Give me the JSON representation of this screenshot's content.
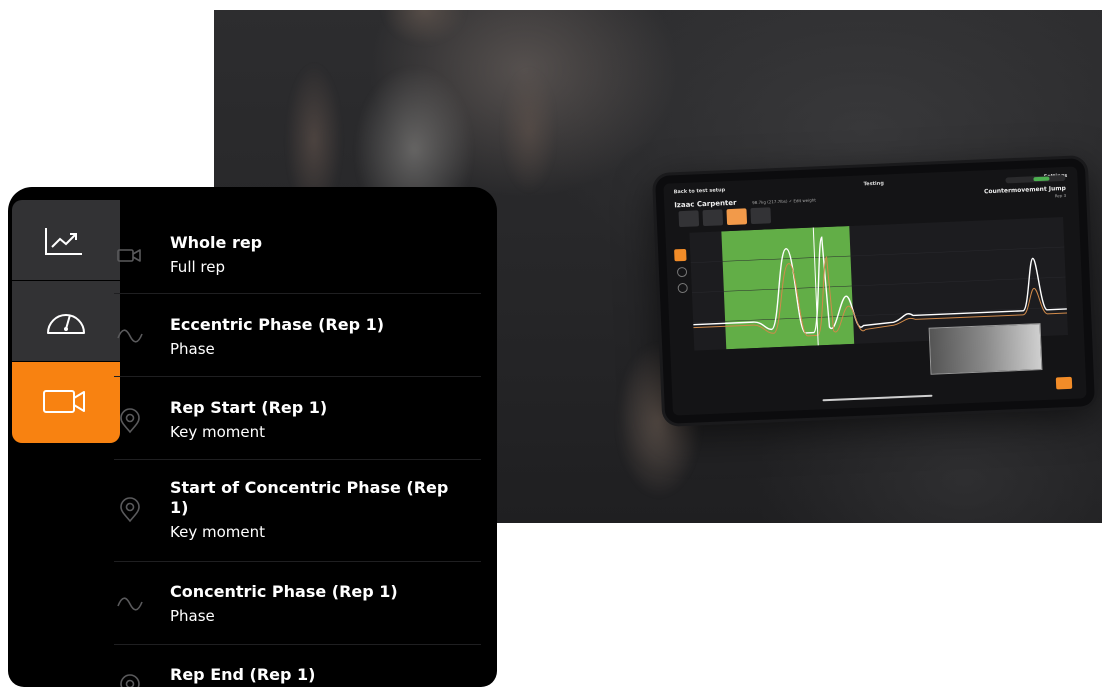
{
  "tablet": {
    "back_label": "Back to test setup",
    "screen_title": "Testing",
    "settings_label": "Settings",
    "athlete_name": "Izaac Carpenter",
    "athlete_weight": "98.7kg (217.7lbs)  ✓ Edit weight",
    "test_name": "Countermovement Jump",
    "rep_label": "Rep 3"
  },
  "panel": {
    "sidebar": [
      {
        "name": "chart-icon",
        "active": false
      },
      {
        "name": "gauge-icon",
        "active": false
      },
      {
        "name": "video-icon",
        "active": true
      }
    ],
    "items": [
      {
        "icon": "video-icon",
        "title": "Whole rep",
        "subtitle": "Full rep"
      },
      {
        "icon": "wave-icon",
        "title": "Eccentric Phase (Rep 1)",
        "subtitle": "Phase"
      },
      {
        "icon": "pin-icon",
        "title": "Rep Start (Rep 1)",
        "subtitle": "Key moment"
      },
      {
        "icon": "pin-icon",
        "title": "Start of Concentric Phase (Rep 1)",
        "subtitle": "Key moment"
      },
      {
        "icon": "wave-icon",
        "title": "Concentric Phase (Rep 1)",
        "subtitle": "Phase"
      },
      {
        "icon": "pin-icon",
        "title": "Rep End (Rep 1)",
        "subtitle": ""
      }
    ]
  },
  "colors": {
    "accent": "#f88211",
    "panel_bg": "#000000",
    "sidebar_bg": "#323234",
    "chart_highlight": "#6abf4b"
  }
}
